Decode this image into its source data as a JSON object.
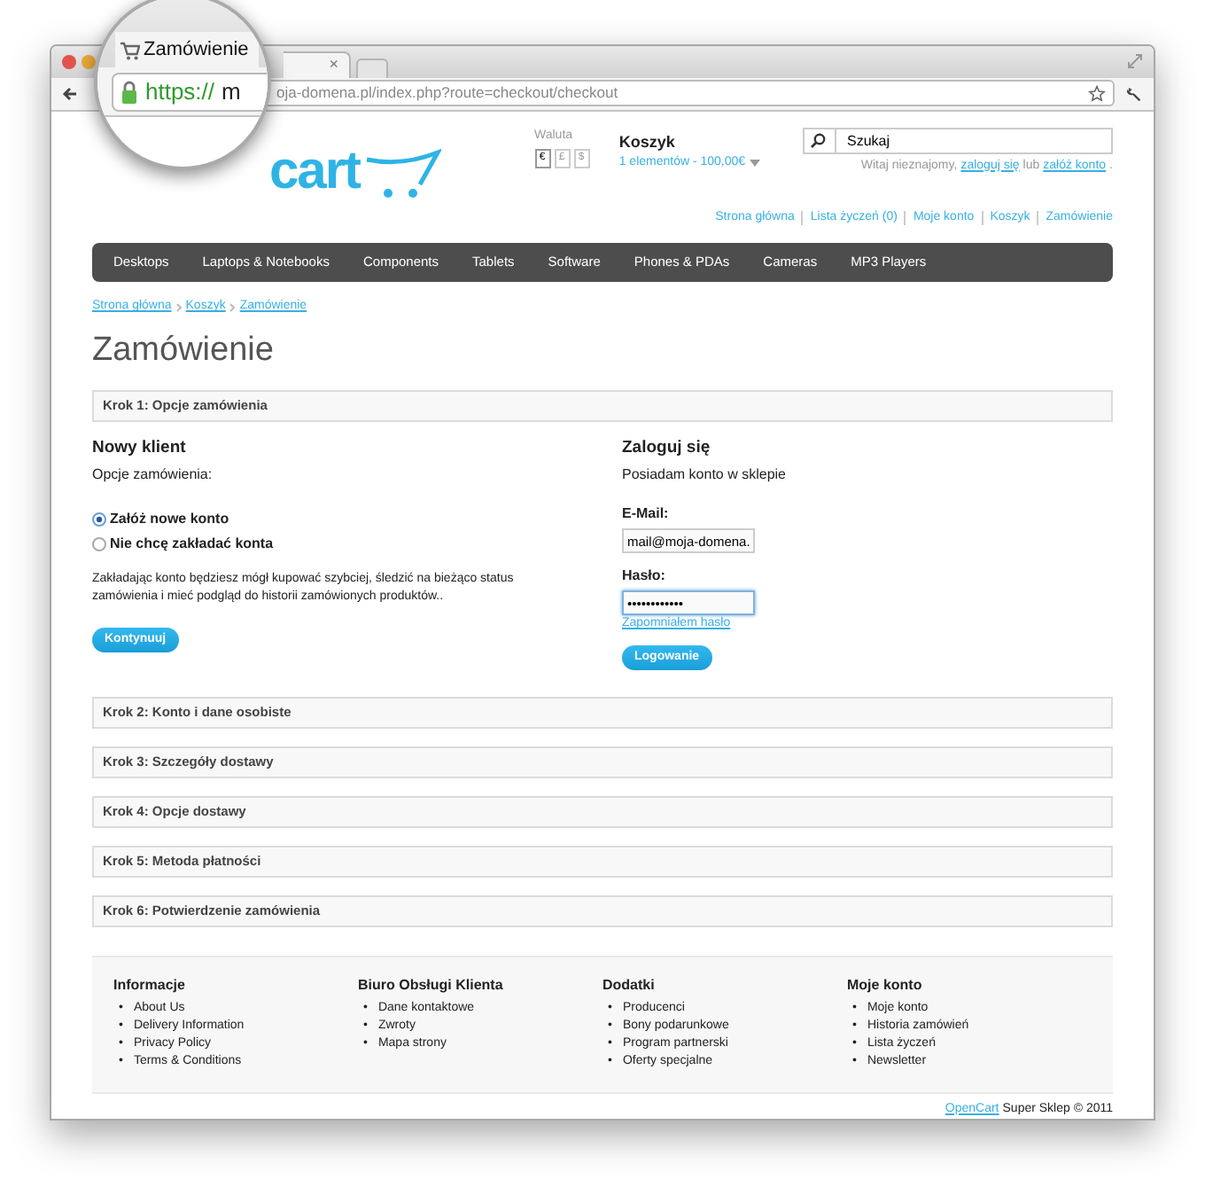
{
  "browser": {
    "tab_title": "Zamówienie",
    "url_scheme": "https://",
    "url_cut_letter": "m",
    "url_rest": "oja-domena.pl/index.php?route=checkout/checkout",
    "tab_close": "×"
  },
  "header": {
    "logo_text": "cart",
    "currency": {
      "label": "Waluta",
      "options": [
        {
          "symbol": "€",
          "selected": true
        },
        {
          "symbol": "£",
          "selected": false
        },
        {
          "symbol": "$",
          "selected": false
        }
      ]
    },
    "cart": {
      "title": "Koszyk",
      "summary": "1 elementów - 100,00€"
    },
    "search": {
      "placeholder": "Szukaj"
    },
    "welcome": [
      {
        "kind": "text",
        "text": "Witaj nieznajomy,"
      },
      {
        "kind": "link",
        "text": "zaloguj się"
      },
      {
        "kind": "text",
        "text": "lub"
      },
      {
        "kind": "link",
        "text": "załóż konto"
      },
      {
        "kind": "text",
        "text": "."
      }
    ],
    "links": [
      "Strona główna",
      "Lista życzeń (0)",
      "Moje konto",
      "Koszyk",
      "Zamówienie"
    ]
  },
  "menu": [
    "Desktops",
    "Laptops & Notebooks",
    "Components",
    "Tablets",
    "Software",
    "Phones & PDAs",
    "Cameras",
    "MP3 Players"
  ],
  "breadcrumb": [
    "Strona główna",
    "Koszyk",
    "Zamówienie"
  ],
  "heading": "Zamówienie",
  "steps": [
    {
      "title": "Krok 1: Opcje zamówienia",
      "body": {
        "new_customer": {
          "title": "Nowy klient",
          "subtitle": "Opcje zamówienia:",
          "options": [
            {
              "label": "Załóż nowe konto",
              "selected": true
            },
            {
              "label": "Nie chcę zakładać konta",
              "selected": false
            }
          ],
          "note": "Zakładając konto będziesz mógł kupować szybciej, śledzić na bieżąco status zamówienia i mieć podgląd do historii zamówionych produktów..",
          "button": "Kontynuuj"
        },
        "login": {
          "title": "Zaloguj się",
          "subtitle": "Posiadam konto w sklepie",
          "email_label": "E-Mail:",
          "email_value": "mail@moja-domena.",
          "password_label": "Hasło:",
          "password_value": "••••••••••••",
          "forgot": "Zapomniałem hasło",
          "button": "Logowanie"
        }
      }
    },
    {
      "title": "Krok 2: Konto i dane osobiste"
    },
    {
      "title": "Krok 3: Szczegóły dostawy"
    },
    {
      "title": "Krok 4: Opcje dostawy"
    },
    {
      "title": "Krok 5: Metoda płatności"
    },
    {
      "title": "Krok 6: Potwierdzenie zamówienia"
    }
  ],
  "footer": {
    "bullet": "•",
    "columns": [
      {
        "title": "Informacje",
        "items": [
          "About Us",
          "Delivery Information",
          "Privacy Policy",
          "Terms & Conditions"
        ]
      },
      {
        "title": "Biuro Obsługi Klienta",
        "items": [
          "Dane kontaktowe",
          "Zwroty",
          "Mapa strony"
        ]
      },
      {
        "title": "Dodatki",
        "items": [
          "Producenci",
          "Bony podarunkowe",
          "Program partnerski",
          "Oferty specjalne"
        ]
      },
      {
        "title": "Moje konto",
        "items": [
          "Moje konto",
          "Historia zamówień",
          "Lista życzeń",
          "Newsletter"
        ]
      }
    ],
    "credit_link": "OpenCart",
    "credit_text": "Super Sklep © 2011"
  }
}
